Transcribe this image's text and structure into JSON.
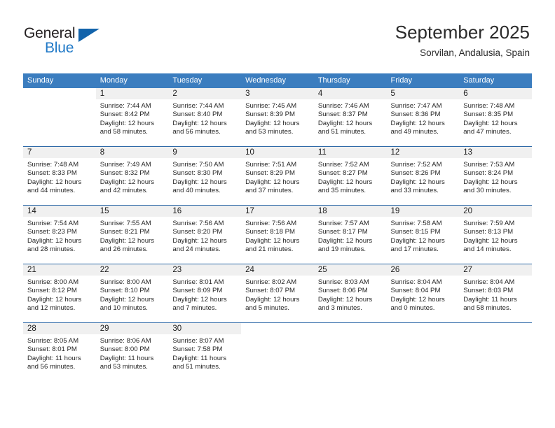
{
  "brand": {
    "name_top": "General",
    "name_bottom": "Blue",
    "triangle_color": "#1263ab",
    "blue_color": "#2079c7"
  },
  "header": {
    "title": "September 2025",
    "subtitle": "Sorvilan, Andalusia, Spain"
  },
  "theme": {
    "header_row_bg": "#3b7dbf",
    "daynum_bg": "#f0f0f0",
    "rule_color": "#2f6aa8"
  },
  "weekday_headers": [
    "Sunday",
    "Monday",
    "Tuesday",
    "Wednesday",
    "Thursday",
    "Friday",
    "Saturday"
  ],
  "weeks": [
    [
      {
        "day": "",
        "sunrise": "",
        "sunset": "",
        "daylight1": "",
        "daylight2": "",
        "blank": true
      },
      {
        "day": "1",
        "sunrise": "Sunrise: 7:44 AM",
        "sunset": "Sunset: 8:42 PM",
        "daylight1": "Daylight: 12 hours",
        "daylight2": "and 58 minutes."
      },
      {
        "day": "2",
        "sunrise": "Sunrise: 7:44 AM",
        "sunset": "Sunset: 8:40 PM",
        "daylight1": "Daylight: 12 hours",
        "daylight2": "and 56 minutes."
      },
      {
        "day": "3",
        "sunrise": "Sunrise: 7:45 AM",
        "sunset": "Sunset: 8:39 PM",
        "daylight1": "Daylight: 12 hours",
        "daylight2": "and 53 minutes."
      },
      {
        "day": "4",
        "sunrise": "Sunrise: 7:46 AM",
        "sunset": "Sunset: 8:37 PM",
        "daylight1": "Daylight: 12 hours",
        "daylight2": "and 51 minutes."
      },
      {
        "day": "5",
        "sunrise": "Sunrise: 7:47 AM",
        "sunset": "Sunset: 8:36 PM",
        "daylight1": "Daylight: 12 hours",
        "daylight2": "and 49 minutes."
      },
      {
        "day": "6",
        "sunrise": "Sunrise: 7:48 AM",
        "sunset": "Sunset: 8:35 PM",
        "daylight1": "Daylight: 12 hours",
        "daylight2": "and 47 minutes."
      }
    ],
    [
      {
        "day": "7",
        "sunrise": "Sunrise: 7:48 AM",
        "sunset": "Sunset: 8:33 PM",
        "daylight1": "Daylight: 12 hours",
        "daylight2": "and 44 minutes."
      },
      {
        "day": "8",
        "sunrise": "Sunrise: 7:49 AM",
        "sunset": "Sunset: 8:32 PM",
        "daylight1": "Daylight: 12 hours",
        "daylight2": "and 42 minutes."
      },
      {
        "day": "9",
        "sunrise": "Sunrise: 7:50 AM",
        "sunset": "Sunset: 8:30 PM",
        "daylight1": "Daylight: 12 hours",
        "daylight2": "and 40 minutes."
      },
      {
        "day": "10",
        "sunrise": "Sunrise: 7:51 AM",
        "sunset": "Sunset: 8:29 PM",
        "daylight1": "Daylight: 12 hours",
        "daylight2": "and 37 minutes."
      },
      {
        "day": "11",
        "sunrise": "Sunrise: 7:52 AM",
        "sunset": "Sunset: 8:27 PM",
        "daylight1": "Daylight: 12 hours",
        "daylight2": "and 35 minutes."
      },
      {
        "day": "12",
        "sunrise": "Sunrise: 7:52 AM",
        "sunset": "Sunset: 8:26 PM",
        "daylight1": "Daylight: 12 hours",
        "daylight2": "and 33 minutes."
      },
      {
        "day": "13",
        "sunrise": "Sunrise: 7:53 AM",
        "sunset": "Sunset: 8:24 PM",
        "daylight1": "Daylight: 12 hours",
        "daylight2": "and 30 minutes."
      }
    ],
    [
      {
        "day": "14",
        "sunrise": "Sunrise: 7:54 AM",
        "sunset": "Sunset: 8:23 PM",
        "daylight1": "Daylight: 12 hours",
        "daylight2": "and 28 minutes."
      },
      {
        "day": "15",
        "sunrise": "Sunrise: 7:55 AM",
        "sunset": "Sunset: 8:21 PM",
        "daylight1": "Daylight: 12 hours",
        "daylight2": "and 26 minutes."
      },
      {
        "day": "16",
        "sunrise": "Sunrise: 7:56 AM",
        "sunset": "Sunset: 8:20 PM",
        "daylight1": "Daylight: 12 hours",
        "daylight2": "and 24 minutes."
      },
      {
        "day": "17",
        "sunrise": "Sunrise: 7:56 AM",
        "sunset": "Sunset: 8:18 PM",
        "daylight1": "Daylight: 12 hours",
        "daylight2": "and 21 minutes."
      },
      {
        "day": "18",
        "sunrise": "Sunrise: 7:57 AM",
        "sunset": "Sunset: 8:17 PM",
        "daylight1": "Daylight: 12 hours",
        "daylight2": "and 19 minutes."
      },
      {
        "day": "19",
        "sunrise": "Sunrise: 7:58 AM",
        "sunset": "Sunset: 8:15 PM",
        "daylight1": "Daylight: 12 hours",
        "daylight2": "and 17 minutes."
      },
      {
        "day": "20",
        "sunrise": "Sunrise: 7:59 AM",
        "sunset": "Sunset: 8:13 PM",
        "daylight1": "Daylight: 12 hours",
        "daylight2": "and 14 minutes."
      }
    ],
    [
      {
        "day": "21",
        "sunrise": "Sunrise: 8:00 AM",
        "sunset": "Sunset: 8:12 PM",
        "daylight1": "Daylight: 12 hours",
        "daylight2": "and 12 minutes."
      },
      {
        "day": "22",
        "sunrise": "Sunrise: 8:00 AM",
        "sunset": "Sunset: 8:10 PM",
        "daylight1": "Daylight: 12 hours",
        "daylight2": "and 10 minutes."
      },
      {
        "day": "23",
        "sunrise": "Sunrise: 8:01 AM",
        "sunset": "Sunset: 8:09 PM",
        "daylight1": "Daylight: 12 hours",
        "daylight2": "and 7 minutes."
      },
      {
        "day": "24",
        "sunrise": "Sunrise: 8:02 AM",
        "sunset": "Sunset: 8:07 PM",
        "daylight1": "Daylight: 12 hours",
        "daylight2": "and 5 minutes."
      },
      {
        "day": "25",
        "sunrise": "Sunrise: 8:03 AM",
        "sunset": "Sunset: 8:06 PM",
        "daylight1": "Daylight: 12 hours",
        "daylight2": "and 3 minutes."
      },
      {
        "day": "26",
        "sunrise": "Sunrise: 8:04 AM",
        "sunset": "Sunset: 8:04 PM",
        "daylight1": "Daylight: 12 hours",
        "daylight2": "and 0 minutes."
      },
      {
        "day": "27",
        "sunrise": "Sunrise: 8:04 AM",
        "sunset": "Sunset: 8:03 PM",
        "daylight1": "Daylight: 11 hours",
        "daylight2": "and 58 minutes."
      }
    ],
    [
      {
        "day": "28",
        "sunrise": "Sunrise: 8:05 AM",
        "sunset": "Sunset: 8:01 PM",
        "daylight1": "Daylight: 11 hours",
        "daylight2": "and 56 minutes."
      },
      {
        "day": "29",
        "sunrise": "Sunrise: 8:06 AM",
        "sunset": "Sunset: 8:00 PM",
        "daylight1": "Daylight: 11 hours",
        "daylight2": "and 53 minutes."
      },
      {
        "day": "30",
        "sunrise": "Sunrise: 8:07 AM",
        "sunset": "Sunset: 7:58 PM",
        "daylight1": "Daylight: 11 hours",
        "daylight2": "and 51 minutes."
      },
      {
        "day": "",
        "sunrise": "",
        "sunset": "",
        "daylight1": "",
        "daylight2": "",
        "blank": true
      },
      {
        "day": "",
        "sunrise": "",
        "sunset": "",
        "daylight1": "",
        "daylight2": "",
        "blank": true
      },
      {
        "day": "",
        "sunrise": "",
        "sunset": "",
        "daylight1": "",
        "daylight2": "",
        "blank": true
      },
      {
        "day": "",
        "sunrise": "",
        "sunset": "",
        "daylight1": "",
        "daylight2": "",
        "blank": true
      }
    ]
  ]
}
